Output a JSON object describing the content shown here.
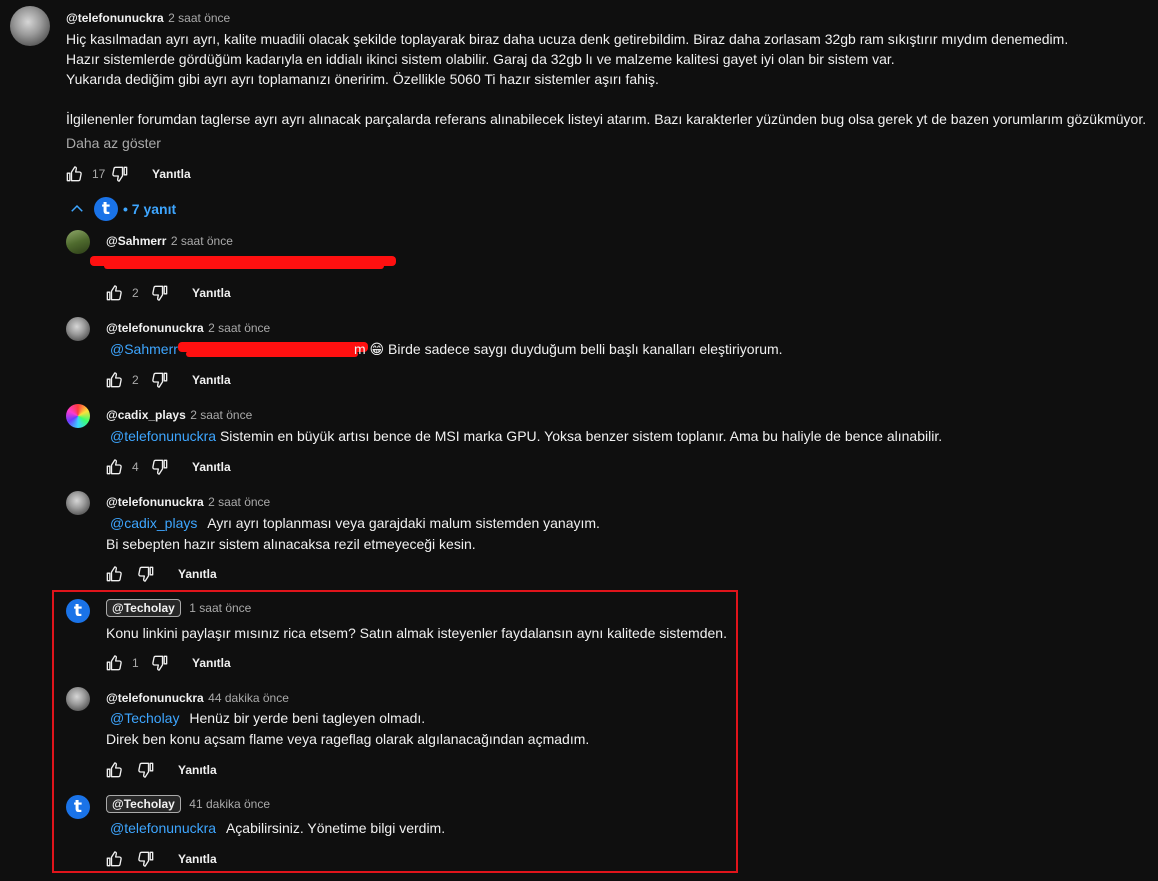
{
  "top_comment": {
    "handle": "@telefonunuckra",
    "time": "2 saat önce",
    "lines": [
      "Hiç kasılmadan ayrı ayrı, kalite muadili olacak şekilde toplayarak biraz daha ucuza denk getirebildim. Biraz daha zorlasam 32gb ram sıkıştırır mıydım denemedim.",
      "Hazır sistemlerde gördüğüm kadarıyla en iddialı ikinci sistem olabilir. Garaj da 32gb lı ve malzeme kalitesi gayet iyi olan bir sistem var.",
      "Yukarıda dediğim gibi ayrı ayrı toplamanızı öneririm. Özellikle 5060 Ti hazır sistemler aşırı fahiş.",
      "İlgilenenler forumdan taglerse ayrı ayrı alınacak parçalarda referans alınabilecek listeyi atarım. Bazı karakterler yüzünden bug olsa gerek yt de bazen yorumlarım gözükmüyor."
    ],
    "show_less": "Daha az göster",
    "likes": "17",
    "reply_label": "Yanıtla"
  },
  "replies_toggle": {
    "avatar_letter": "t",
    "label": "• 7 yanıt"
  },
  "replies": [
    {
      "handle": "@Sahmerr",
      "time": "2 saat önce",
      "likes": "2",
      "reply_label": "Yanıtla"
    },
    {
      "handle": "@telefonunuckra",
      "time": "2 saat önce",
      "mention": "@Sahmerr",
      "tail": "m 😁 Birde sadece saygı duyduğum belli başlı kanalları eleştiriyorum.",
      "likes": "2",
      "reply_label": "Yanıtla"
    },
    {
      "handle": "@cadix_plays",
      "time": "2 saat önce",
      "mention": "@telefonunuckra",
      "text": "Sistemin en büyük artısı bence de MSI marka GPU. Yoksa benzer sistem toplanır. Ama bu haliyle de bence alınabilir.",
      "likes": "4",
      "reply_label": "Yanıtla"
    },
    {
      "handle": "@telefonunuckra",
      "time": "2 saat önce",
      "mention": "@cadix_plays",
      "text": "Ayrı ayrı toplanması veya garajdaki malum sistemden yanayım.",
      "text2": "Bi sebepten hazır sistem alınacaksa rezil etmeyeceği kesin.",
      "likes": "",
      "reply_label": "Yanıtla"
    },
    {
      "handle": "@Techolay",
      "time": "1 saat önce",
      "text": "Konu linkini paylaşır mısınız rica etsem? Satın almak isteyenler faydalansın aynı kalitede sistemden.",
      "likes": "1",
      "reply_label": "Yanıtla",
      "avatar_letter": "t"
    },
    {
      "handle": "@telefonunuckra",
      "time": "44 dakika önce",
      "mention": "@Techolay",
      "text": "Henüz bir yerde beni tagleyen olmadı.",
      "text2": "Direk ben konu açsam flame veya rageflag olarak algılanacağından açmadım.",
      "likes": "",
      "reply_label": "Yanıtla"
    },
    {
      "handle": "@Techolay",
      "time": "41 dakika önce",
      "mention": "@telefonunuckra",
      "text": "Açabilirsiniz. Yönetime bilgi verdim.",
      "likes": "",
      "reply_label": "Yanıtla",
      "avatar_letter": "t"
    }
  ],
  "colors": {
    "background": "#0f0f0f",
    "mention": "#3ea6ff",
    "highlight_box": "#e0141b",
    "redaction": "#ff1010",
    "brand": "#1a73e8"
  }
}
